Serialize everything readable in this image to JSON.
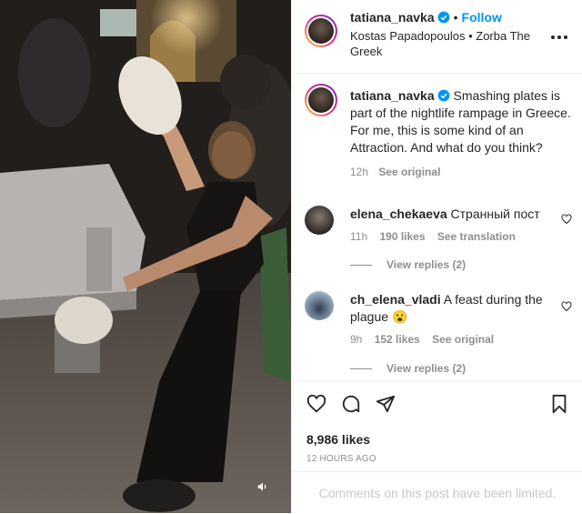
{
  "header": {
    "username": "tatiana_navka",
    "separator": "•",
    "follow_label": "Follow",
    "location": "Kostas Papadopoulos • Zorba The Greek"
  },
  "caption": {
    "username": "tatiana_navka",
    "text": "Smashing plates is part of the nightlife rampage in Greece. For me, this is some kind of an Attraction. And what do you think?",
    "time": "12h",
    "see_original": "See original"
  },
  "comments": [
    {
      "username": "elena_chekaeva",
      "text": "Странный пост",
      "time": "11h",
      "likes": "190 likes",
      "action": "See translation",
      "view_replies": "View replies (2)"
    },
    {
      "username": "ch_elena_vladi",
      "text": "A feast during the plague",
      "emoji": "😮",
      "time": "9h",
      "likes": "152 likes",
      "action": "See original",
      "view_replies": "View replies (2)"
    }
  ],
  "footer": {
    "likes": "8,986 likes",
    "posted_ago": "12 HOURS AGO",
    "comments_limited": "Comments on this post have been limited."
  },
  "icons": {
    "verified": "verified-badge-icon",
    "more": "more-options-icon",
    "like": "heart-icon",
    "comment": "comment-icon",
    "share": "share-icon",
    "save": "bookmark-icon",
    "audio": "speaker-icon"
  },
  "colors": {
    "accent": "#0095f6",
    "muted": "#8e8e8e",
    "text": "#262626"
  }
}
